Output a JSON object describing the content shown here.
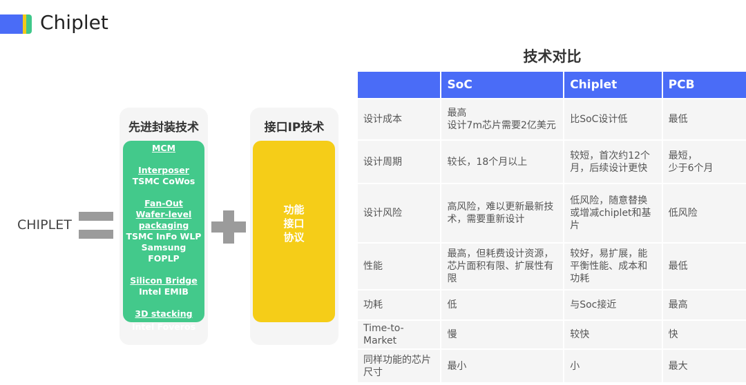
{
  "header": {
    "title": "Chiplet",
    "logo_colors": [
      "#4a6cf7",
      "#f2c919",
      "#3fc88a"
    ]
  },
  "equation": {
    "left_label": "CHIPLET",
    "equals_icon": "equals-icon",
    "plus_icon": "plus-icon",
    "packaging": {
      "title": "先进封装技术",
      "groups": [
        {
          "heading": "MCM",
          "lines": []
        },
        {
          "heading": "Interposer",
          "lines": [
            "TSMC CoWos"
          ]
        },
        {
          "heading": "Fan-Out Wafer-level packaging",
          "heading_lines": [
            "Fan-Out",
            "Wafer-level",
            "packaging"
          ],
          "lines": [
            "TSMC InFo WLP",
            "Samsung",
            "FOPLP"
          ]
        },
        {
          "heading": "Silicon Bridge",
          "lines": [
            "Intel EMIB"
          ]
        },
        {
          "heading": "3D stacking",
          "lines": [
            "Intel Foveros"
          ]
        }
      ]
    },
    "interface": {
      "title": "接口IP技术",
      "lines": [
        "功能",
        "接口",
        "协议"
      ]
    }
  },
  "comparison": {
    "title": "技术对比",
    "columns": [
      "",
      "SoC",
      "Chiplet",
      "PCB"
    ],
    "rows": [
      {
        "label": "设计成本",
        "soc": "最高\n设计7m芯片需要2亿美元",
        "chiplet": "比SoC设计低",
        "pcb": "最低"
      },
      {
        "label": "设计周期",
        "soc": "较长，18个月以上",
        "chiplet": "较短，首次约12个月，后续设计更快",
        "pcb": "最短，\n少于6个月"
      },
      {
        "label": "设计风险",
        "soc": "高风险，难以更新最新技术，需要重新设计",
        "chiplet": "低风险，随意替换或增减chiplet和基片",
        "pcb": "低风险"
      },
      {
        "label": "性能",
        "soc": "最高，但耗费设计资源，芯片面积有限、扩展性有限",
        "chiplet": "较好，易扩展，能平衡性能、成本和功耗",
        "pcb": "最低"
      },
      {
        "label": "功耗",
        "soc": "低",
        "chiplet": "与Soc接近",
        "pcb": "最高"
      },
      {
        "label": "Time-to-Market",
        "soc": "慢",
        "chiplet": "较快",
        "pcb": "快"
      },
      {
        "label": "同样功能的芯片尺寸",
        "soc": "最小",
        "chiplet": "小",
        "pcb": "最大"
      }
    ]
  }
}
